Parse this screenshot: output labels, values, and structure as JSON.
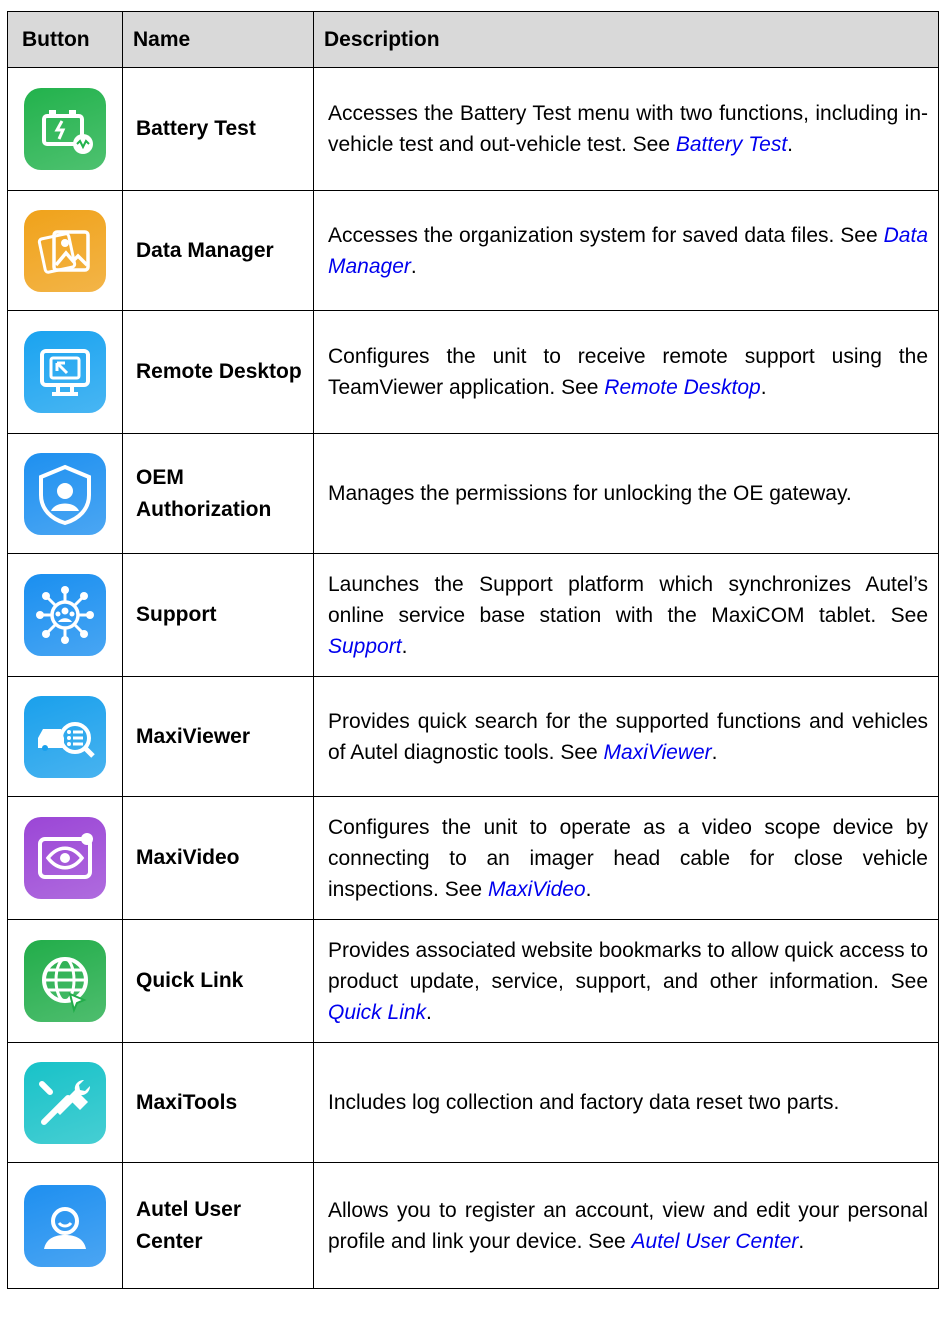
{
  "headers": {
    "button": "Button",
    "name": "Name",
    "description": "Description"
  },
  "rows": [
    {
      "icon": "battery-test-icon",
      "color": "#22b24c",
      "name": "Battery Test",
      "desc": "Accesses the Battery Test menu with two functions, including in-vehicle test and out-vehicle test. See ",
      "link": "Battery Test",
      "tail": "."
    },
    {
      "icon": "data-manager-icon",
      "color": "#f0a21a",
      "name": "Data Manager",
      "desc": "Accesses the organization system for saved data files. See ",
      "link": "Data Manager",
      "tail": "."
    },
    {
      "icon": "remote-desktop-icon",
      "color": "#1aa3f0",
      "name": "Remote Desktop",
      "desc": "Configures the unit to receive remote support using the TeamViewer application. See ",
      "link": "Remote Desktop",
      "tail": "."
    },
    {
      "icon": "oem-authorization-icon",
      "color": "#1e90f0",
      "name": "OEM Authorization",
      "desc": "Manages the permissions for unlocking the OE gateway.",
      "link": "",
      "tail": ""
    },
    {
      "icon": "support-icon",
      "color": "#1a8ff0",
      "name": "Support",
      "desc": "Launches the Support platform which synchronizes Autel’s online service base station with the MaxiCOM tablet. See ",
      "link": "Support",
      "tail": "."
    },
    {
      "icon": "maxiviewer-icon",
      "color": "#1aa0ec",
      "name": "MaxiViewer",
      "desc": "Provides quick search for the supported functions and vehicles of Autel diagnostic tools. See ",
      "link": "MaxiViewer",
      "tail": "."
    },
    {
      "icon": "maxivideo-icon",
      "color": "#9b46d6",
      "name": "MaxiVideo",
      "desc": "Configures the unit to operate as a video scope device by connecting to an imager head cable for close vehicle inspections. See ",
      "link": "MaxiVideo",
      "tail": "."
    },
    {
      "icon": "quick-link-icon",
      "color": "#22ad4a",
      "name": "Quick Link",
      "desc": "Provides associated website bookmarks to allow quick access to product update, service, support, and other information. See ",
      "link": "Quick Link",
      "tail": "."
    },
    {
      "icon": "maxitools-icon",
      "color": "#18c2c8",
      "name": "MaxiTools",
      "desc": "Includes log collection and factory data reset two parts.",
      "link": "",
      "tail": ""
    },
    {
      "icon": "autel-user-center-icon",
      "color": "#1e8ff0",
      "name": "Autel User Center",
      "desc": "Allows you to register an account, view and edit your personal profile and link your device. See ",
      "link": "Autel User Center",
      "tail": "."
    }
  ]
}
